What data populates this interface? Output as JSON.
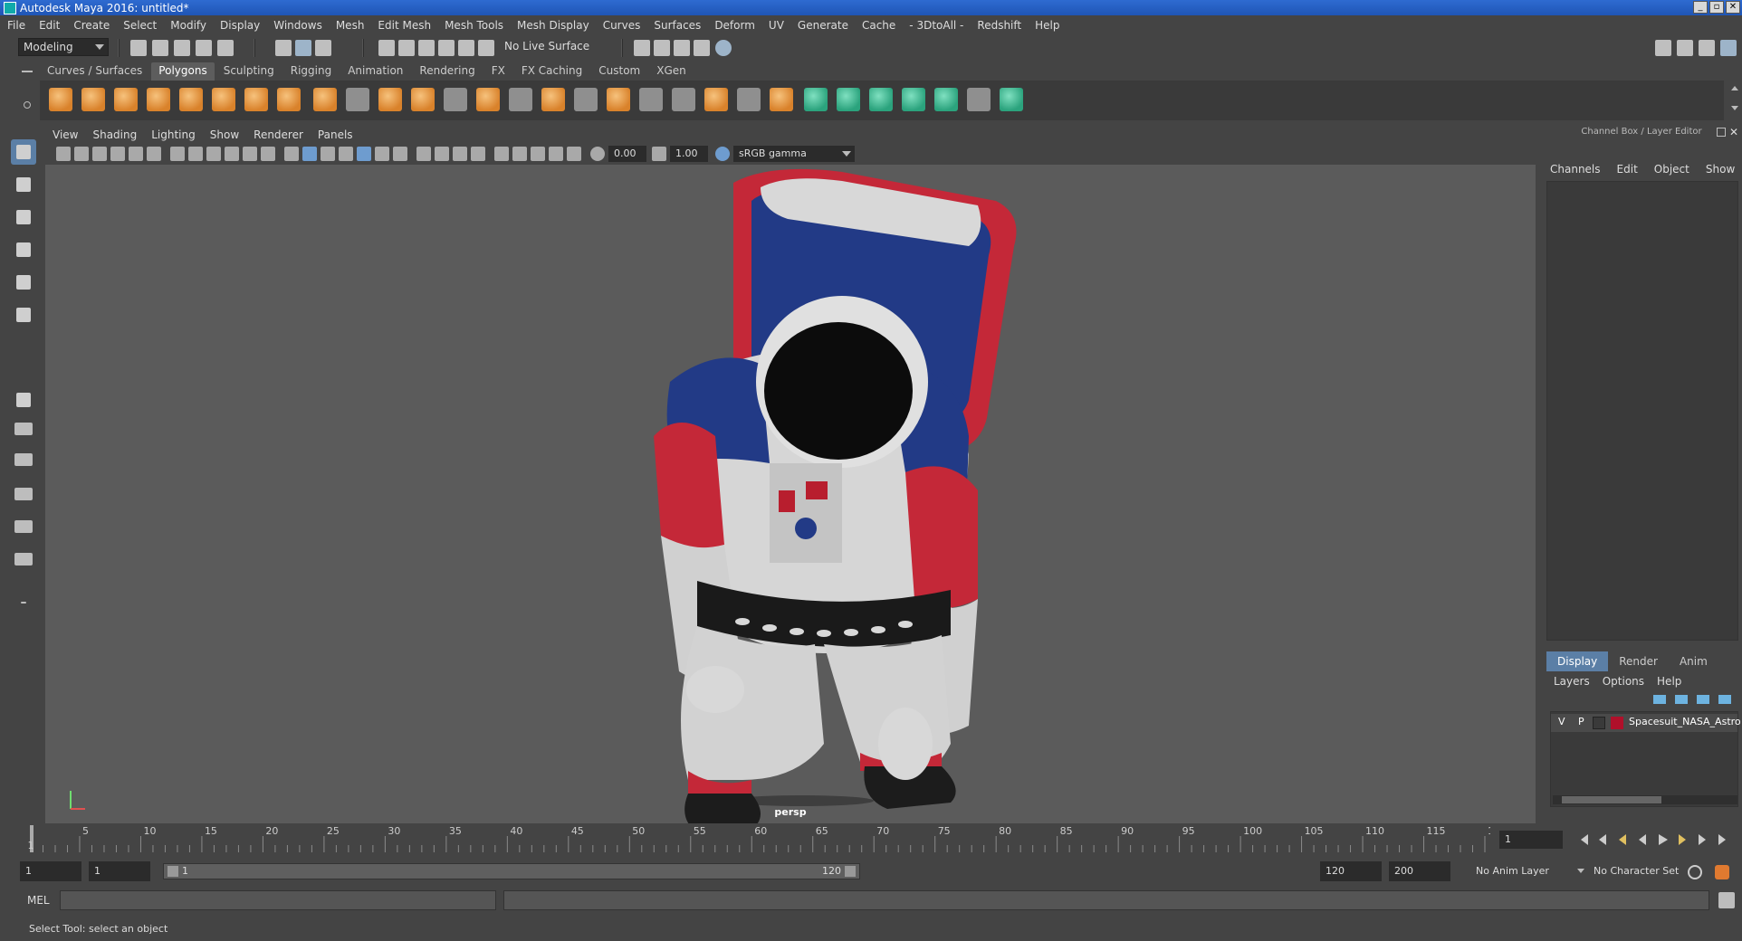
{
  "window": {
    "title": "Autodesk Maya 2016: untitled*"
  },
  "menubar": [
    "File",
    "Edit",
    "Create",
    "Select",
    "Modify",
    "Display",
    "Windows",
    "Mesh",
    "Edit Mesh",
    "Mesh Tools",
    "Mesh Display",
    "Curves",
    "Surfaces",
    "Deform",
    "UV",
    "Generate",
    "Cache",
    "- 3DtoAll -",
    "Redshift",
    "Help"
  ],
  "statusline": {
    "menuset": "Modeling",
    "live_surface": "No Live Surface"
  },
  "shelf": {
    "tabs": [
      "Curves / Surfaces",
      "Polygons",
      "Sculpting",
      "Rigging",
      "Animation",
      "Rendering",
      "FX",
      "FX Caching",
      "Custom",
      "XGen"
    ],
    "active": "Polygons"
  },
  "viewport": {
    "menus": [
      "View",
      "Shading",
      "Lighting",
      "Show",
      "Renderer",
      "Panels"
    ],
    "exposure": "0.00",
    "gamma": "1.00",
    "color_space": "sRGB gamma",
    "camera": "persp"
  },
  "right_panel": {
    "title": "Channel Box / Layer Editor",
    "menus": [
      "Channels",
      "Edit",
      "Object",
      "Show"
    ],
    "tabs": [
      "Display",
      "Render",
      "Anim"
    ],
    "active_tab": "Display",
    "layer_menus": [
      "Layers",
      "Options",
      "Help"
    ],
    "layer": {
      "v": "V",
      "p": "P",
      "name": "Spacesuit_NASA_Astro",
      "color": "#b0102a"
    }
  },
  "timeline": {
    "ticks": [
      1,
      5,
      10,
      15,
      20,
      25,
      30,
      35,
      40,
      45,
      50,
      55,
      60,
      65,
      70,
      75,
      80,
      85,
      90,
      95,
      100,
      105,
      110,
      115,
      120
    ],
    "labels": [
      "5",
      "10",
      "15",
      "20",
      "25",
      "30",
      "35",
      "40",
      "45",
      "50",
      "55",
      "60",
      "65",
      "70",
      "75",
      "80",
      "85",
      "90",
      "95",
      "100",
      "105",
      "110",
      "115",
      "120"
    ],
    "start_label": "1",
    "current_frame": "1"
  },
  "range": {
    "start": "1",
    "playback_start": "1",
    "slider_start": "1",
    "slider_end": "120",
    "playback_end": "120",
    "end": "200",
    "anim_layer": "No Anim Layer",
    "character_set": "No Character Set"
  },
  "command": {
    "label": "MEL"
  },
  "status": {
    "help": "Select Tool: select an object"
  }
}
